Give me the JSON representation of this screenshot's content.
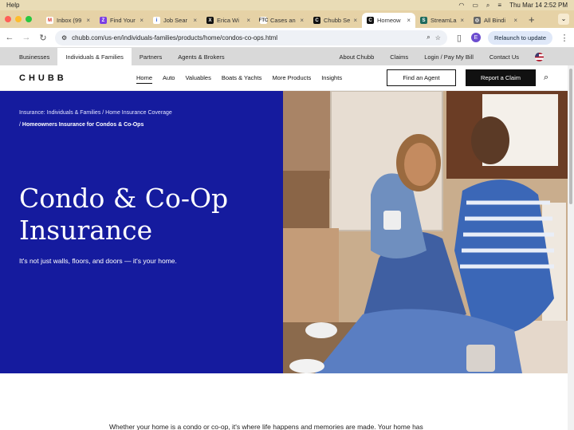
{
  "macbar": {
    "app_menu": "Help",
    "clock": "Thu Mar 14  2:52 PM"
  },
  "browser": {
    "tabs": [
      {
        "label": "Inbox (99",
        "fav_color": "#ffffff",
        "fav_glyph": "M",
        "fav_text": "#d93025"
      },
      {
        "label": "Find Your",
        "fav_color": "#7b3fe4",
        "fav_glyph": "Z",
        "fav_text": "#ffffff"
      },
      {
        "label": "Job Sear",
        "fav_color": "#ffffff",
        "fav_glyph": "i",
        "fav_text": "#1a4fd6"
      },
      {
        "label": "Erica Wi",
        "fav_color": "#111111",
        "fav_glyph": "X",
        "fav_text": "#ffffff"
      },
      {
        "label": "Cases an",
        "fav_color": "#ffffff",
        "fav_glyph": "FTC",
        "fav_text": "#333333"
      },
      {
        "label": "Chubb Se",
        "fav_color": "#111111",
        "fav_glyph": "C",
        "fav_text": "#ffffff"
      },
      {
        "label": "Homeow",
        "fav_color": "#111111",
        "fav_glyph": "C",
        "fav_text": "#ffffff",
        "active": true
      },
      {
        "label": "StreamLa",
        "fav_color": "#1e6b5e",
        "fav_glyph": "S",
        "fav_text": "#ffffff"
      },
      {
        "label": "All Bindi",
        "fav_color": "#666666",
        "fav_glyph": "◎",
        "fav_text": "#ffffff"
      }
    ],
    "new_tab": "+",
    "url": "chubb.com/us-en/individuals-families/products/home/condos-co-ops.html",
    "profile_initial": "E",
    "relaunch_label": "Relaunch to update"
  },
  "util_nav": {
    "left": [
      "Businesses",
      "Individuals & Families",
      "Partners",
      "Agents & Brokers"
    ],
    "right": [
      "About Chubb",
      "Claims",
      "Login / Pay My Bill",
      "Contact Us"
    ]
  },
  "main_nav": {
    "logo": "CHUBB",
    "items": [
      "Home",
      "Auto",
      "Valuables",
      "Boats & Yachts",
      "More Products",
      "Insights"
    ],
    "find_agent": "Find an Agent",
    "report_claim": "Report a Claim"
  },
  "hero": {
    "breadcrumb_1": "Insurance: Individuals & Families",
    "breadcrumb_sep": " / ",
    "breadcrumb_2": "Home Insurance Coverage",
    "breadcrumb_3": "Homeowners Insurance for Condos & Co-Ops",
    "title_line1": "Condo & Co-Op",
    "title_line2": "Insurance",
    "subtitle": "It's not just walls, floors, and doors — it's your home."
  },
  "below": {
    "paragraph": "Whether your home is a condo or co-op, it's where life happens and memories are made. Your home has"
  },
  "colors": {
    "hero_blue": "#151b9e",
    "accent_black": "#111111"
  }
}
